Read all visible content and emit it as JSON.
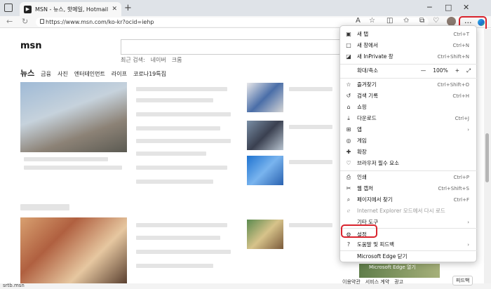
{
  "browser": {
    "tab_title": "MSN - 뉴스, 핫메일, Hotmail, Sk",
    "tab_close": "✕",
    "new_tab": "+",
    "url": "https://www.msn.com/ko-kr?ocid=iehp",
    "more_label": "···"
  },
  "page": {
    "logo": "msn",
    "recent_label": "최근 검색:",
    "recent_items": [
      "네이버",
      "크롬"
    ],
    "categories_main": "뉴스",
    "categories": [
      "금융",
      "사진",
      "엔터테인먼트",
      "라이프",
      "코로나19특집"
    ],
    "status_text": "srtb.msn",
    "footer_links": [
      "이용약관",
      "서비스 계약",
      "광고"
    ],
    "feedback": "피드백",
    "news_thumb_caption": "Microsoft Edge 열기"
  },
  "menu": {
    "items": [
      {
        "icon": "new-tab-icon",
        "glyph": "▣",
        "label": "새 탭",
        "shortcut": "Ctrl+T"
      },
      {
        "icon": "new-window-icon",
        "glyph": "□",
        "label": "새 창에서",
        "shortcut": "Ctrl+N"
      },
      {
        "icon": "inprivate-icon",
        "glyph": "◪",
        "label": "새 InPrivate 창",
        "shortcut": "Ctrl+Shift+N"
      },
      {
        "icon": "favorites-icon",
        "glyph": "☆",
        "label": "즐겨찾기",
        "shortcut": "Ctrl+Shift+O"
      },
      {
        "icon": "history-icon",
        "glyph": "↺",
        "label": "검색 기록",
        "shortcut": "Ctrl+H"
      },
      {
        "icon": "shopping-icon",
        "glyph": "⌂",
        "label": "쇼핑",
        "shortcut": ""
      },
      {
        "icon": "downloads-icon",
        "glyph": "⤓",
        "label": "다운로드",
        "shortcut": "Ctrl+J"
      },
      {
        "icon": "apps-icon",
        "glyph": "⊞",
        "label": "앱",
        "shortcut": "›"
      },
      {
        "icon": "games-icon",
        "glyph": "◎",
        "label": "게임",
        "shortcut": ""
      },
      {
        "icon": "extensions-icon",
        "glyph": "✚",
        "label": "확장",
        "shortcut": ""
      },
      {
        "icon": "browser-essentials-icon",
        "glyph": "♡",
        "label": "브라우저 필수 요소",
        "shortcut": ""
      },
      {
        "icon": "print-icon",
        "glyph": "⎙",
        "label": "인쇄",
        "shortcut": "Ctrl+P"
      },
      {
        "icon": "web-capture-icon",
        "glyph": "✂",
        "label": "웹 캡처",
        "shortcut": "Ctrl+Shift+S"
      },
      {
        "icon": "find-icon",
        "glyph": "⌕",
        "label": "페이지에서 찾기",
        "shortcut": "Ctrl+F"
      },
      {
        "icon": "ie-mode-icon",
        "glyph": "ℯ",
        "label": "Internet Explorer 모드에서 다시 로드",
        "shortcut": ""
      },
      {
        "icon": "more-tools-icon",
        "glyph": "",
        "label": "기타 도구",
        "shortcut": "›"
      },
      {
        "icon": "settings-icon",
        "glyph": "⚙",
        "label": "설정",
        "shortcut": ""
      },
      {
        "icon": "help-icon",
        "glyph": "?",
        "label": "도움말 및 피드백",
        "shortcut": "›"
      },
      {
        "icon": "close-edge-icon",
        "glyph": "",
        "label": "Microsoft Edge 닫기",
        "shortcut": ""
      }
    ],
    "zoom": {
      "label": "확대/축소",
      "minus": "—",
      "value": "100%",
      "plus": "+",
      "fullscreen": "⤢"
    }
  },
  "colors": {
    "highlight": "#d9232d",
    "menu_bg": "#ffffff"
  }
}
